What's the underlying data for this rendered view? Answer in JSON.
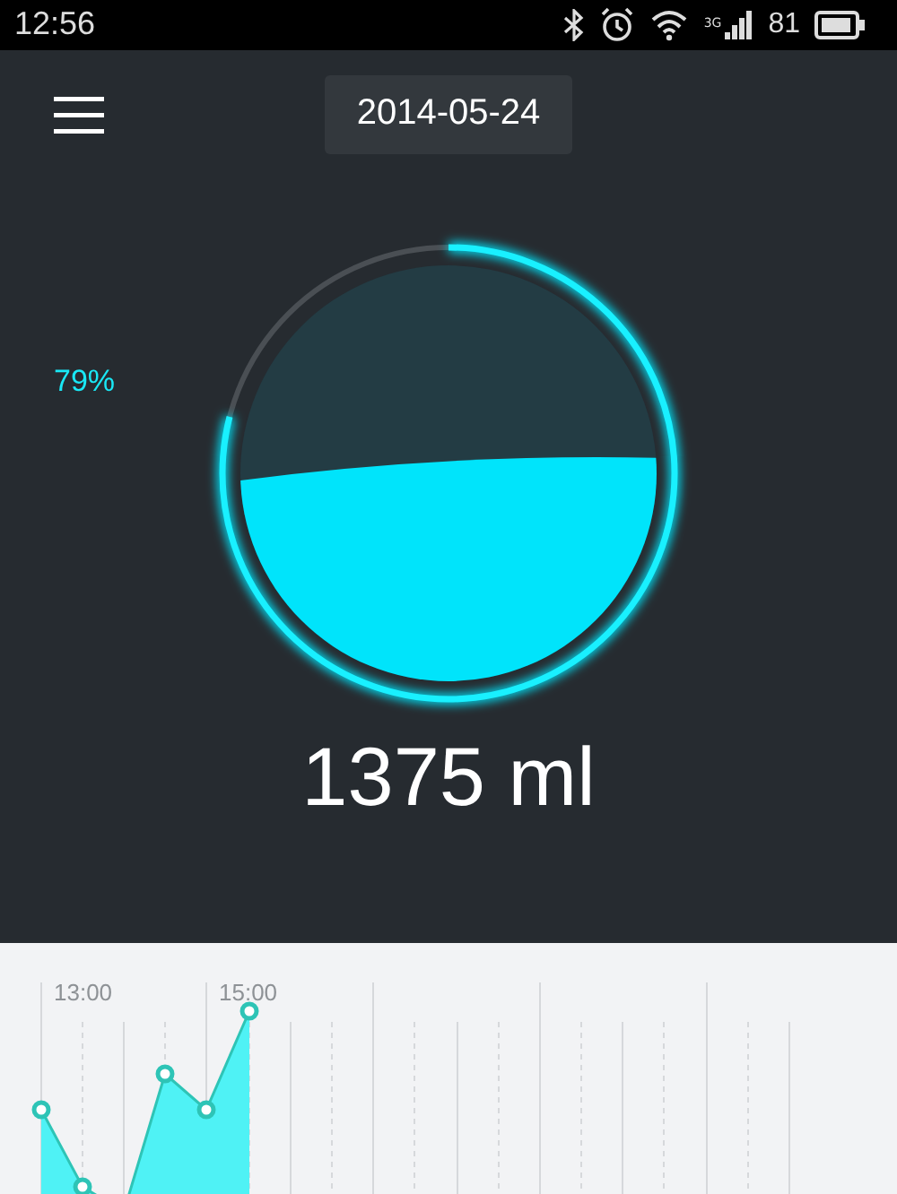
{
  "status_bar": {
    "time": "12:56",
    "network": "3G",
    "battery": "81"
  },
  "header": {
    "date": "2014-05-24"
  },
  "gauge": {
    "level": 0.79,
    "percent": "79%",
    "amount": "1375 ml"
  },
  "chart": {
    "time_labels": [
      "13:00",
      "15:00"
    ]
  }
}
